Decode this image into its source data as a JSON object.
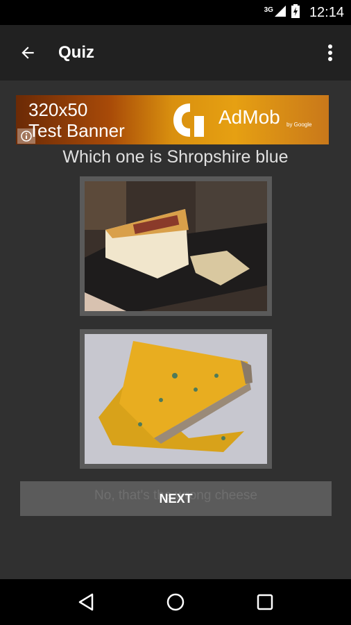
{
  "status_bar": {
    "network": "3G",
    "time": "12:14",
    "icons": [
      "signal-icon",
      "battery-charging-icon"
    ]
  },
  "app_bar": {
    "title": "Quiz",
    "back_icon": "arrow-back-icon",
    "menu_icon": "more-vert-icon"
  },
  "ad": {
    "size_text": "320x50",
    "banner_text": "Test Banner",
    "brand": "AdMob",
    "by": "by Google",
    "info_icon": "info-icon"
  },
  "quiz": {
    "question": "Which one is Shropshire blue",
    "options": [
      {
        "image": "cheese-wedge-with-cracker"
      },
      {
        "image": "shropshire-blue-cheese"
      }
    ],
    "feedback": "No, that's the wrong cheese",
    "next_label": "NEXT"
  },
  "nav_bar": {
    "icons": [
      "back-triangle-icon",
      "home-circle-icon",
      "recents-square-icon"
    ]
  },
  "colors": {
    "background": "#303030",
    "app_bar": "#212121",
    "button": "#5b5b5b"
  }
}
